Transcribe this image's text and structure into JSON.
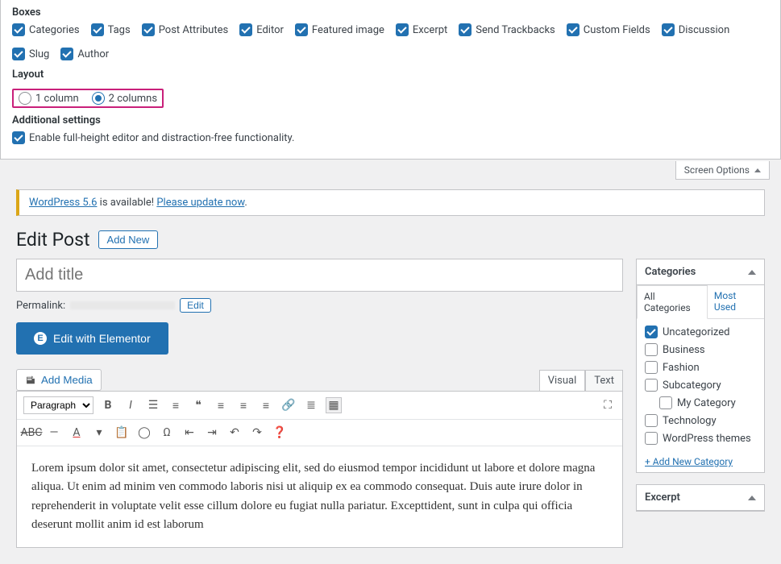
{
  "screenOptions": {
    "tabLabel": "Screen Options",
    "boxesTitle": "Boxes",
    "boxes": [
      {
        "label": "Categories",
        "checked": true
      },
      {
        "label": "Tags",
        "checked": true
      },
      {
        "label": "Post Attributes",
        "checked": true
      },
      {
        "label": "Editor",
        "checked": true
      },
      {
        "label": "Featured image",
        "checked": true
      },
      {
        "label": "Excerpt",
        "checked": true
      },
      {
        "label": "Send Trackbacks",
        "checked": true
      },
      {
        "label": "Custom Fields",
        "checked": true
      },
      {
        "label": "Discussion",
        "checked": true
      },
      {
        "label": "Slug",
        "checked": true
      },
      {
        "label": "Author",
        "checked": true
      }
    ],
    "layoutTitle": "Layout",
    "layoutOptions": [
      {
        "label": "1 column",
        "checked": false
      },
      {
        "label": "2 columns",
        "checked": true
      }
    ],
    "additionalTitle": "Additional settings",
    "additional": {
      "label": "Enable full-height editor and distraction-free functionality.",
      "checked": true
    }
  },
  "notice": {
    "linkA": "WordPress 5.6",
    "mid": " is available! ",
    "linkB": "Please update now"
  },
  "header": {
    "pageTitle": "Edit Post",
    "addNew": "Add New"
  },
  "post": {
    "titlePlaceholder": "Add title",
    "permalinkLabel": "Permalink:",
    "editBtn": "Edit",
    "elementorBtn": "Edit with Elementor",
    "addMedia": "Add Media",
    "tabs": {
      "visual": "Visual",
      "text": "Text"
    },
    "formatSelect": "Paragraph",
    "content": "Lorem ipsum dolor sit amet, consectetur adipiscing elit, sed do eiusmod tempor incididunt ut labore et dolore magna aliqua. Ut enim ad minim ven commodo laboris nisi ut aliquip ex ea commodo consequat. Duis aute irure dolor in reprehenderit in voluptate velit esse cillum dolore eu fugiat nulla pariatur. Excepttident, sunt in culpa qui officia deserunt mollit anim id est laborum"
  },
  "sidebar": {
    "categories": {
      "title": "Categories",
      "tabAll": "All Categories",
      "tabMost": "Most Used",
      "items": [
        {
          "label": "Uncategorized",
          "checked": true,
          "indent": false
        },
        {
          "label": "Business",
          "checked": false,
          "indent": false
        },
        {
          "label": "Fashion",
          "checked": false,
          "indent": false
        },
        {
          "label": "Subcategory",
          "checked": false,
          "indent": false
        },
        {
          "label": "My Category",
          "checked": false,
          "indent": true
        },
        {
          "label": "Technology",
          "checked": false,
          "indent": false
        },
        {
          "label": "WordPress themes",
          "checked": false,
          "indent": false
        }
      ],
      "addNew": "+ Add New Category"
    },
    "excerpt": {
      "title": "Excerpt"
    }
  }
}
